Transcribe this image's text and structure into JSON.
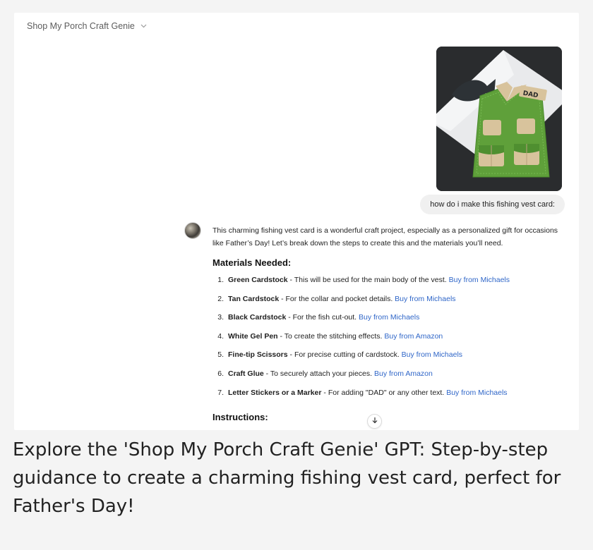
{
  "app": {
    "title": "Shop My Porch Craft Genie",
    "title_chevron": "chevron-down-icon"
  },
  "conversation": {
    "user_message": "how do i make this fishing vest card:",
    "image_label": "DAD",
    "assistant": {
      "intro": "This charming fishing vest card is a wonderful craft project, especially as a personalized gift for occasions like Father’s Day! Let’s break down the steps to create this and the materials you’ll need.",
      "materials_heading": "Materials Needed:",
      "materials": [
        {
          "num": "1.",
          "name": "Green Cardstock",
          "desc": " - This will be used for the main body of the vest. ",
          "link": "Buy from Michaels"
        },
        {
          "num": "2.",
          "name": "Tan Cardstock",
          "desc": " - For the collar and pocket details. ",
          "link": "Buy from Michaels"
        },
        {
          "num": "3.",
          "name": "Black Cardstock",
          "desc": " - For the fish cut-out. ",
          "link": "Buy from Michaels"
        },
        {
          "num": "4.",
          "name": "White Gel Pen",
          "desc": " - To create the stitching effects. ",
          "link": "Buy from Amazon"
        },
        {
          "num": "5.",
          "name": "Fine-tip Scissors",
          "desc": " - For precise cutting of cardstock. ",
          "link": "Buy from Michaels"
        },
        {
          "num": "6.",
          "name": "Craft Glue",
          "desc": " - To securely attach your pieces. ",
          "link": "Buy from Amazon"
        },
        {
          "num": "7.",
          "name": "Letter Stickers or a Marker",
          "desc": " - For adding \"DAD\" or any other text. ",
          "link": "Buy from Michaels"
        }
      ],
      "instructions_heading": "Instructions:"
    }
  },
  "caption": "Explore the 'Shop My Porch Craft Genie' GPT: Step-by-step guidance to create a charming fishing vest card, perfect for Father's Day!",
  "colors": {
    "link": "#2f66c8",
    "bubble": "#f0f0f0",
    "vest_green": "#5fa03a",
    "tan": "#d8c39c"
  }
}
